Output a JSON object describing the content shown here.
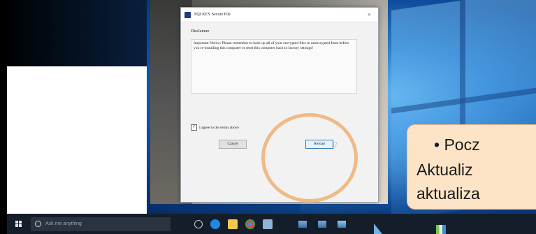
{
  "dialog": {
    "title": "PQI KEY Secure File",
    "close_glyph": "×",
    "heading": "Disclaimer",
    "notice": "Important Notice: Please remember to back up all of your encrypted files in unencrypted form before you re-installing this computer or reset this computer back to factory settings!",
    "agree_checked_glyph": "✓",
    "agree_label": "I agree to the terms above",
    "cancel_label": "Cancel",
    "reload_label": "Reload"
  },
  "callout": {
    "line1": "• Pocz",
    "line2": "Aktualiz",
    "line3": "aktualiza"
  },
  "taskbar": {
    "search_placeholder": "Ask me anything",
    "icons": [
      "task-view-icon",
      "edge-icon",
      "file-explorer-icon",
      "chrome-icon",
      "store-icon"
    ],
    "tray": [
      "network-icon",
      "network-icon-2",
      "network-icon-3"
    ]
  },
  "colors": {
    "highlight_ring": "#f0ba86",
    "callout_bg": "#fde4c7",
    "taskbar_bg": "#141e2a",
    "desktop_blue": "#0e4b9a"
  }
}
